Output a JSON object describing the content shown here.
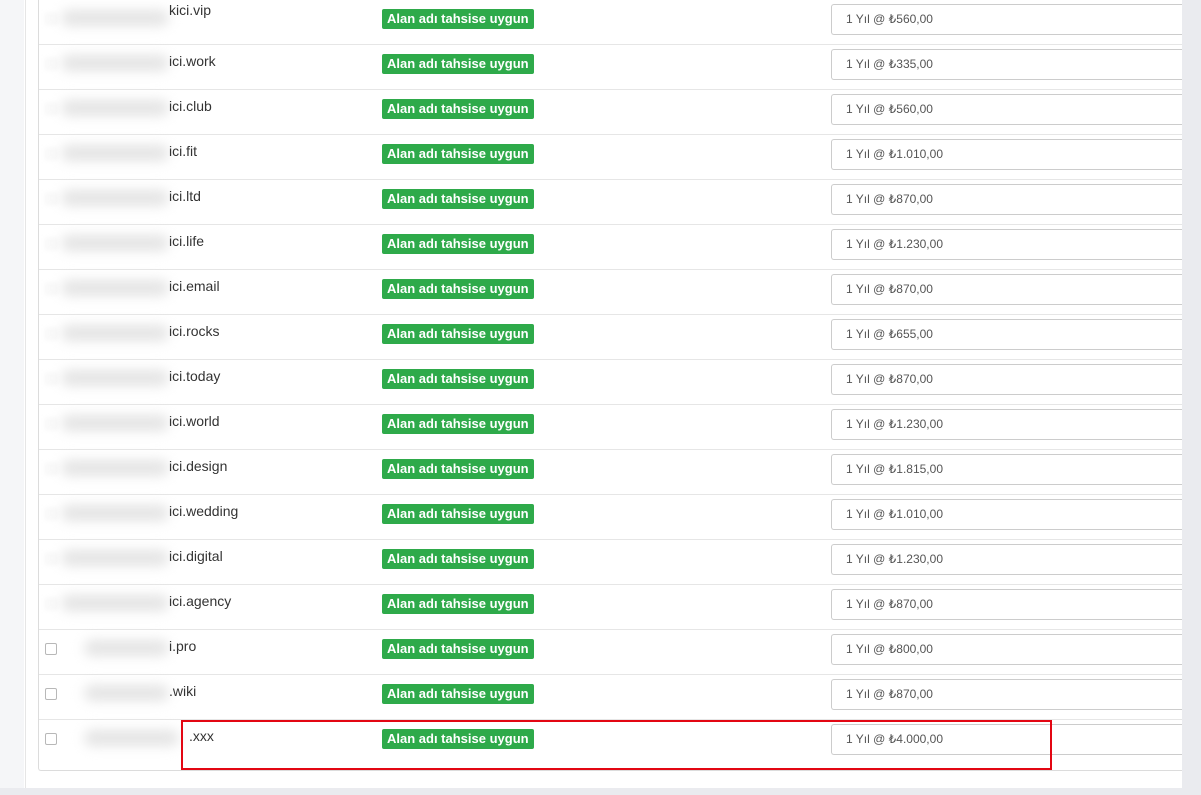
{
  "status_label": "Alan adı tahsise uygun",
  "highlight_color": "#e30613",
  "badge_color": "#2eaa4a",
  "domains": [
    {
      "domain": "kici.vip",
      "price": "1 Yıl @ ₺560,00"
    },
    {
      "domain": "ici.work",
      "price": "1 Yıl @ ₺335,00"
    },
    {
      "domain": "ici.club",
      "price": "1 Yıl @ ₺560,00"
    },
    {
      "domain": "ici.fit",
      "price": "1 Yıl @ ₺1.010,00"
    },
    {
      "domain": "ici.ltd",
      "price": "1 Yıl @ ₺870,00"
    },
    {
      "domain": "ici.life",
      "price": "1 Yıl @ ₺1.230,00"
    },
    {
      "domain": "ici.email",
      "price": "1 Yıl @ ₺870,00"
    },
    {
      "domain": "ici.rocks",
      "price": "1 Yıl @ ₺655,00"
    },
    {
      "domain": "ici.today",
      "price": "1 Yıl @ ₺870,00"
    },
    {
      "domain": "ici.world",
      "price": "1 Yıl @ ₺1.230,00"
    },
    {
      "domain": "ici.design",
      "price": "1 Yıl @ ₺1.815,00"
    },
    {
      "domain": "ici.wedding",
      "price": "1 Yıl @ ₺1.010,00"
    },
    {
      "domain": "ici.digital",
      "price": "1 Yıl @ ₺1.230,00"
    },
    {
      "domain": "ici.agency",
      "price": "1 Yıl @ ₺870,00"
    },
    {
      "domain": "i.pro",
      "price": "1 Yıl @ ₺800,00"
    },
    {
      "domain": ".wiki",
      "price": "1 Yıl @ ₺870,00"
    },
    {
      "domain": ".xxx",
      "price": "1 Yıl @ ₺4.000,00"
    }
  ]
}
